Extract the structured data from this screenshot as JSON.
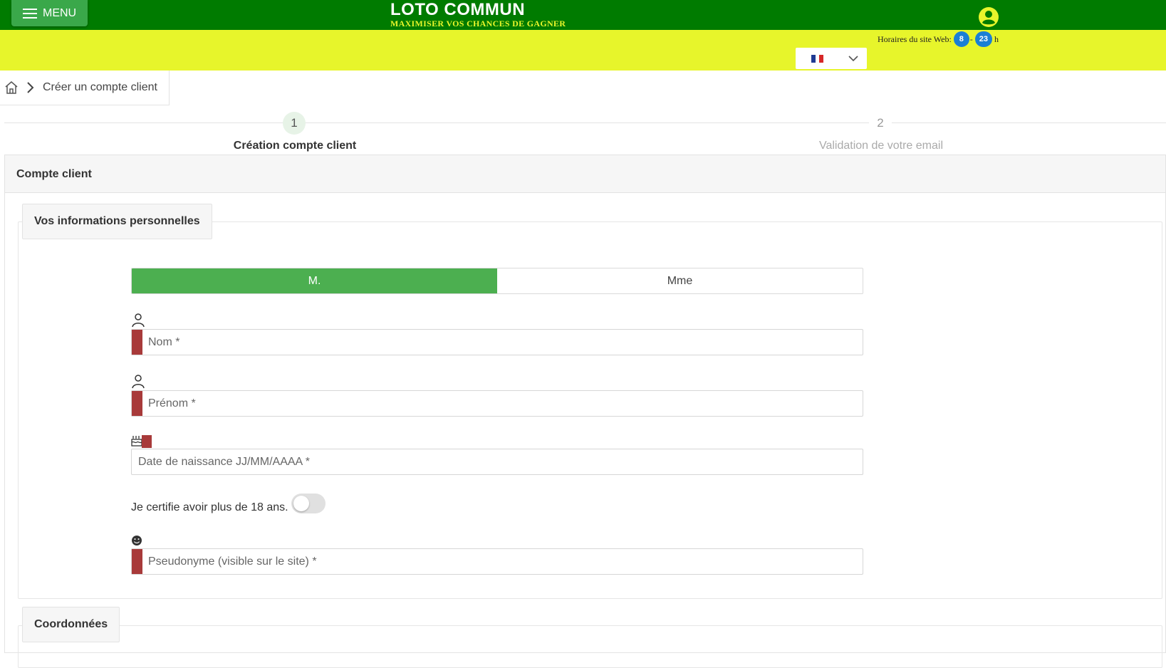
{
  "header": {
    "menu_label": "MENU",
    "logo_title": "LOTO COMMUN",
    "logo_tagline": "MAXIMISER VOS CHANCES DE GAGNER",
    "hours_label": "Horaires du site Web:",
    "hours_open": "8",
    "hours_dash": "-",
    "hours_close": "23",
    "hours_unit": "h",
    "language": "fr",
    "colors": {
      "green": "#007b00",
      "yellow": "#e7f52b",
      "badge": "#1a7fd4"
    }
  },
  "breadcrumb": {
    "current": "Créer un compte client"
  },
  "stepper": {
    "steps": [
      {
        "number": "1",
        "label": "Création compte client"
      },
      {
        "number": "2",
        "label": "Validation de votre email"
      }
    ]
  },
  "card": {
    "title": "Compte client",
    "personal": {
      "legend": "Vos informations personnelles",
      "gender_options": [
        "M.",
        "Mme"
      ],
      "gender_selected": "M.",
      "nom_placeholder": "Nom *",
      "prenom_placeholder": "Prénom *",
      "birthdate_placeholder": "Date de naissance JJ/MM/AAAA *",
      "certify_label": "Je certifie avoir plus de 18 ans.",
      "pseudo_placeholder": "Pseudonyme (visible sur le site) *"
    },
    "coordinates": {
      "legend": "Coordonnées"
    }
  }
}
